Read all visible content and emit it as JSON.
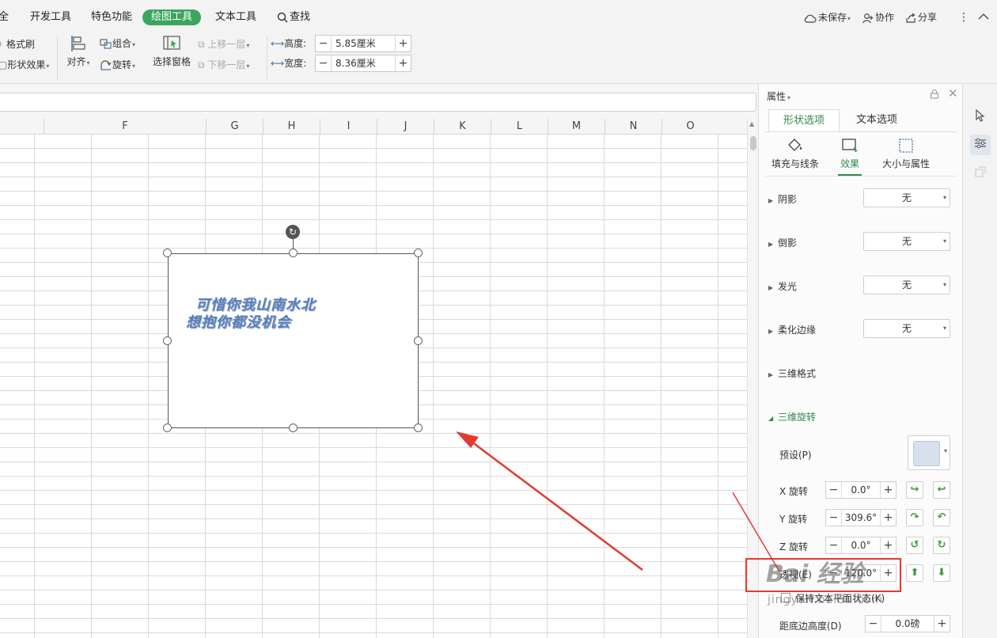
{
  "tabs": [
    {
      "label": "全",
      "active": false
    },
    {
      "label": "开发工具",
      "active": false
    },
    {
      "label": "特色功能",
      "active": false
    },
    {
      "label": "绘图工具",
      "active": true
    },
    {
      "label": "文本工具",
      "active": false
    },
    {
      "label": "查找",
      "active": false
    }
  ],
  "toolbar_right": {
    "unsaved": "未保存",
    "collab": "协作",
    "share": "分享",
    "more": "⋮",
    "collapse": "^"
  },
  "ribbon": {
    "format_painter": "格式刷",
    "shape_effect": "形状效果",
    "align": "对齐",
    "group": "组合",
    "rotate": "旋转",
    "selection_pane": "选择窗格",
    "bring_forward": "上移一层",
    "send_backward": "下移一层",
    "height_label": "高度:",
    "height_value": "5.85厘米",
    "width_label": "宽度:",
    "width_value": "8.36厘米"
  },
  "sheet": {
    "columns": [
      "F",
      "G",
      "H",
      "I",
      "J",
      "K",
      "L",
      "M",
      "N",
      "O"
    ]
  },
  "shape_text": {
    "line1": "可惜你我山南水北",
    "line2": "想抱你都没机会"
  },
  "pane": {
    "title": "属性",
    "tabs": [
      {
        "label": "形状选项",
        "active": true
      },
      {
        "label": "文本选项",
        "active": false
      }
    ],
    "subtabs": [
      {
        "label": "填充与线条",
        "active": false
      },
      {
        "label": "效果",
        "active": true
      },
      {
        "label": "大小与属性",
        "active": false
      }
    ],
    "sections": [
      {
        "label": "阴影",
        "value": "无"
      },
      {
        "label": "倒影",
        "value": "无"
      },
      {
        "label": "发光",
        "value": "无"
      },
      {
        "label": "柔化边缘",
        "value": "无"
      },
      {
        "label": "三维格式",
        "value": ""
      },
      {
        "label": "三维旋转",
        "value": ""
      }
    ],
    "rotation": {
      "preset_label": "预设(P)",
      "x_label": "X 旋转",
      "x_value": "0.0°",
      "y_label": "Y 旋转",
      "y_value": "309.6°",
      "z_label": "Z 旋转",
      "z_value": "0.0°",
      "perspective_label": "透视(E)",
      "perspective_value": "120.0°",
      "keep_text_flat": "保持文本平面状态(K)",
      "distance_label": "距底边高度(D)",
      "distance_value": "0.0磅"
    }
  },
  "watermark": {
    "logo": "Bai 经验",
    "url": "jingyan.baidu.com"
  },
  "colors": {
    "accent_green": "#3aa55c",
    "annotation_red": "#e53935",
    "wordart_blue": "#5b7fb8"
  }
}
